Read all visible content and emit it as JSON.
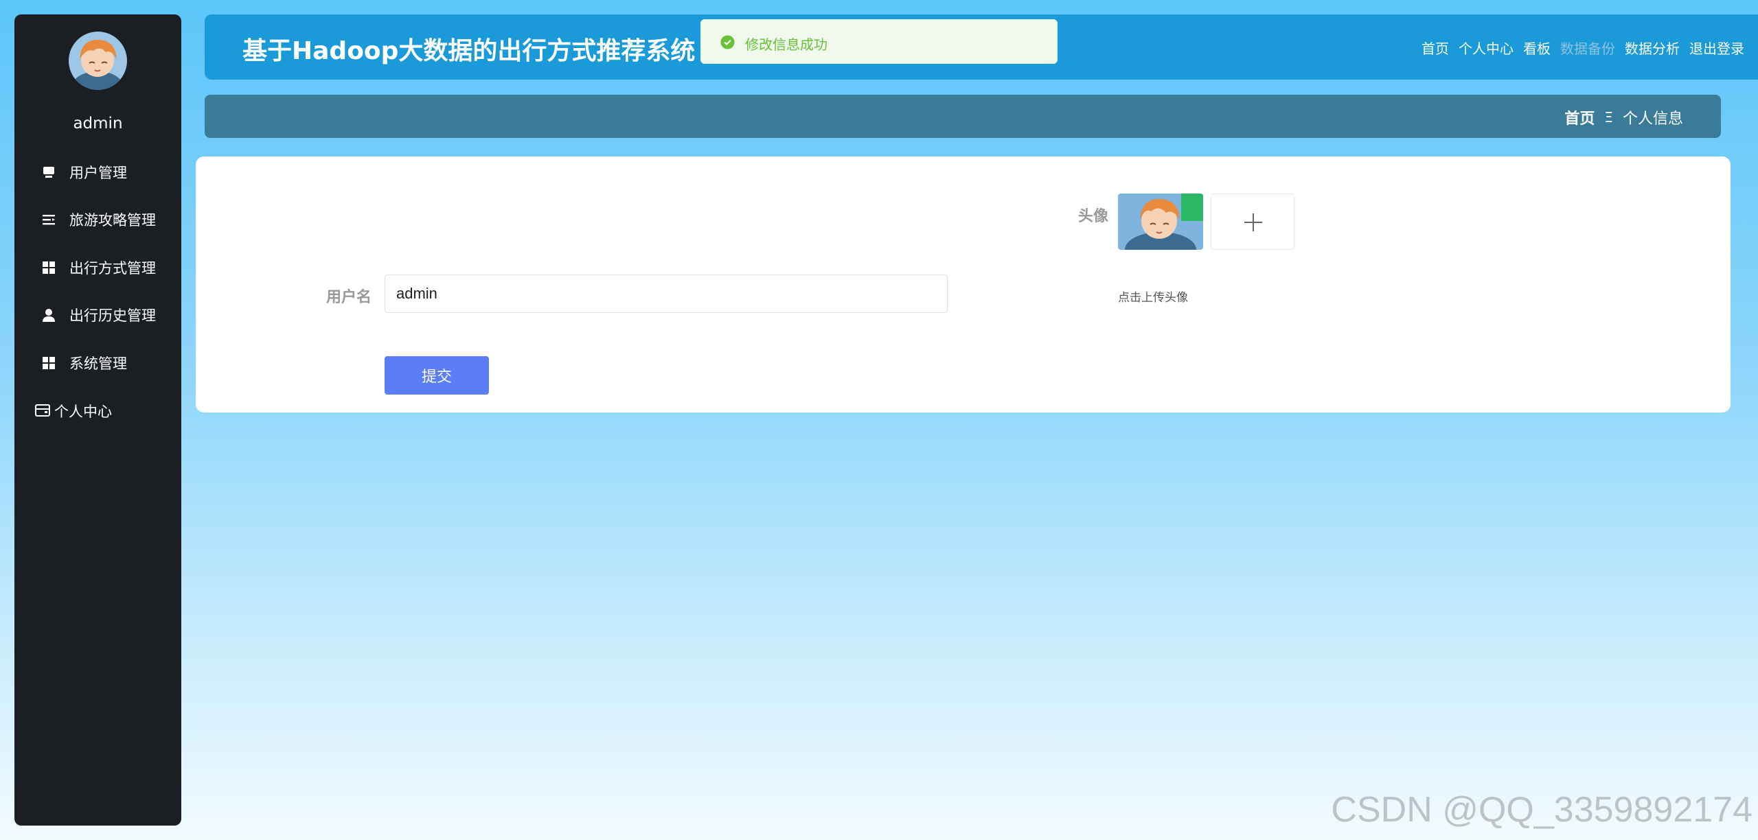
{
  "sidebar": {
    "username": "admin",
    "avatar_icon": "cartoon-avatar",
    "items": [
      {
        "label": "用户管理",
        "icon": "user-card-icon"
      },
      {
        "label": "旅游攻略管理",
        "icon": "list-icon"
      },
      {
        "label": "出行方式管理",
        "icon": "grid-icon"
      },
      {
        "label": "出行历史管理",
        "icon": "person-icon"
      },
      {
        "label": "系统管理",
        "icon": "grid-icon"
      },
      {
        "label": "个人中心",
        "icon": "wallet-icon"
      }
    ]
  },
  "header": {
    "title": "基于Hadoop大数据的出行方式推荐系统",
    "nav": [
      "首页",
      "个人中心",
      "看板",
      "数据备份",
      "数据分析",
      "退出登录"
    ]
  },
  "toast": {
    "message": "修改信息成功",
    "type": "success",
    "color": "#67c23a"
  },
  "breadcrumb": {
    "home": "首页",
    "separator": "Ξ",
    "current": "个人信息"
  },
  "form": {
    "username_label": "用户名",
    "username_value": "admin",
    "submit_label": "提交",
    "avatar_label": "头像",
    "upload_hint": "点击上传头像"
  },
  "watermark": "CSDN @QQ_3359892174",
  "colors": {
    "sidebar_bg": "#1b1f24",
    "header_bg": "#1a9ad8",
    "breadcrumb_bg": "#3a7b9a",
    "button_bg": "#5b7df5"
  }
}
